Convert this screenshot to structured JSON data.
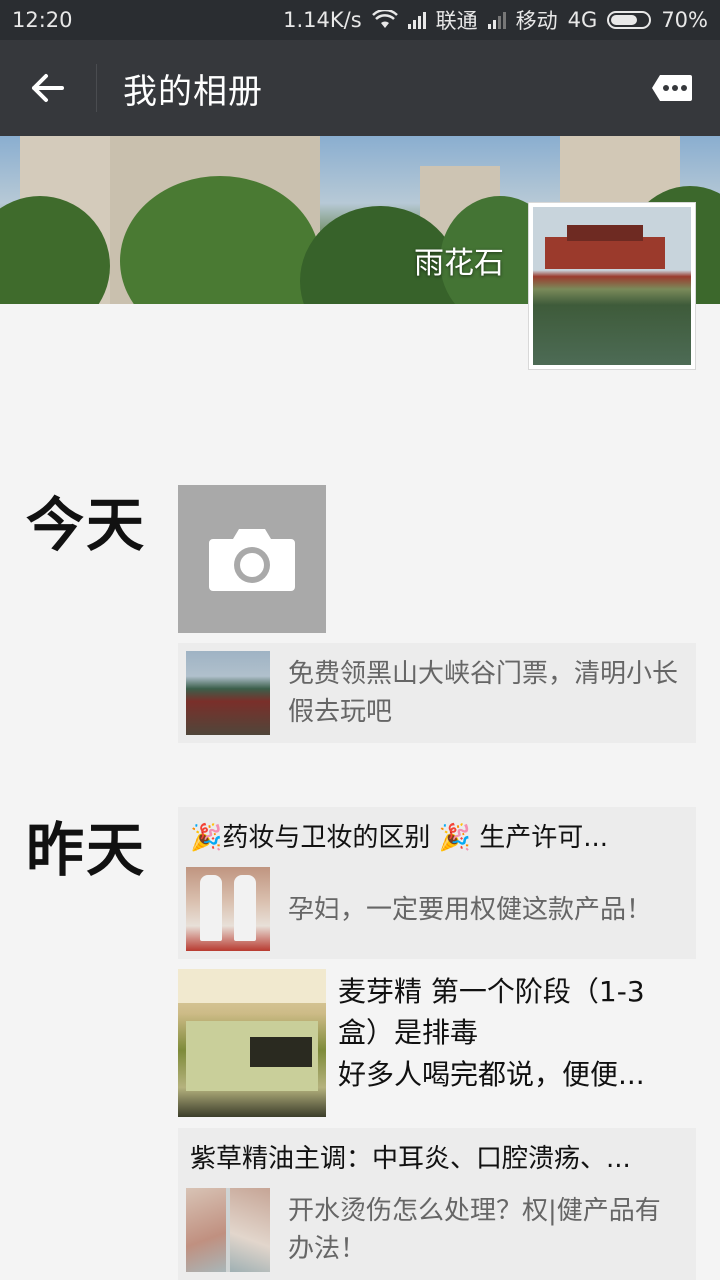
{
  "status_bar": {
    "time": "12:20",
    "speed": "1.14K/s",
    "carrier1": "联通",
    "carrier2": "移动",
    "network": "4G",
    "battery": "70%",
    "battery_level": 0.7
  },
  "header": {
    "title": "我的相册",
    "back_icon": "arrow-left-icon",
    "more_icon": "more-icon"
  },
  "profile": {
    "username": "雨花石"
  },
  "timeline": [
    {
      "day": "今天",
      "camera_icon": "camera-icon",
      "link_text": "免费领黑山大峡谷门票，清明小长假去玩吧"
    },
    {
      "day": "昨天",
      "share1_title": "🎉药妆与卫妆的区别 🎉 生产许可...",
      "share1_text": "孕妇，一定要用权健这款产品！",
      "post_line1": "麦芽精  第一个阶段（1-3",
      "post_line2": "盒）是排毒",
      "post_line3": "好多人喝完都说，便便...",
      "share2_title": "紫草精油主调：中耳炎、口腔溃疡、...",
      "share2_text": "开水烫伤怎么处理？权|健产品有办法！"
    }
  ]
}
